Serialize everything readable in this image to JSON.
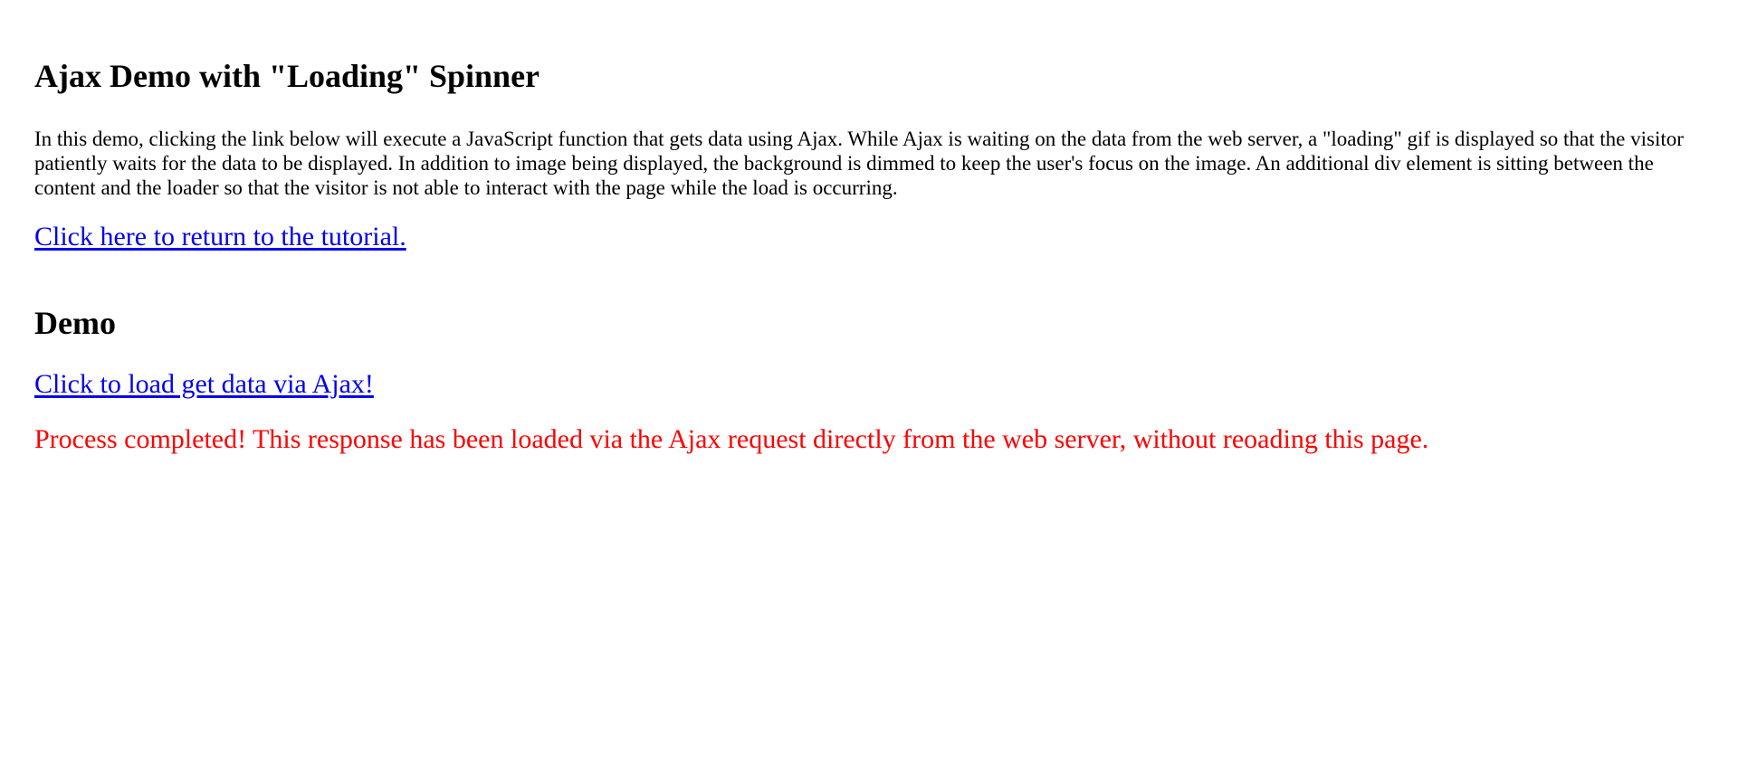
{
  "header": {
    "title": "Ajax Demo with \"Loading\" Spinner"
  },
  "intro": {
    "text": "In this demo, clicking the link below will execute a JavaScript function that gets data using Ajax. While Ajax is waiting on the data from the web server, a \"loading\" gif is displayed so that the visitor patiently waits for the data to be displayed. In addition to image being displayed, the background is dimmed to keep the user's focus on the image. An additional div element is sitting between the content and the loader so that the visitor is not able to interact with the page while the load is occurring."
  },
  "links": {
    "tutorial": "Click here to return to the tutorial.",
    "load_data": "Click to load get data via Ajax!"
  },
  "demo": {
    "title": "Demo",
    "result_text": "Process completed! This response has been loaded via the Ajax request directly from the web server, without reoading this page.",
    "result_color": "#ff0000"
  },
  "colors": {
    "link": "#0000ee",
    "text": "#000000",
    "background": "#ffffff"
  }
}
